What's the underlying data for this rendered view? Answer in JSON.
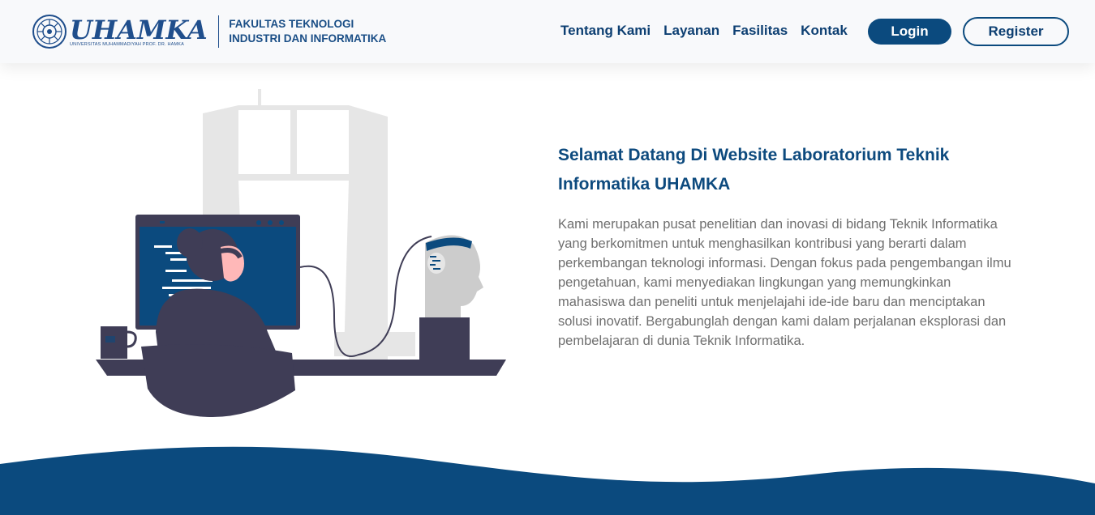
{
  "header": {
    "logo_text": "UHAMKA",
    "logo_subtext": "UNIVERSITAS MUHAMMADIYAH PROF. DR. HAMKA",
    "faculty_line1": "FAKULTAS TEKNOLOGI",
    "faculty_line2": "INDUSTRI DAN INFORMATIKA"
  },
  "nav": {
    "items": [
      {
        "label": "Tentang Kami"
      },
      {
        "label": "Layanan"
      },
      {
        "label": "Fasilitas"
      },
      {
        "label": "Kontak"
      }
    ],
    "login_label": "Login",
    "register_label": "Register"
  },
  "hero": {
    "title": "Selamat Datang Di Website Laboratorium Teknik Informatika UHAMKA",
    "description": "Kami merupakan pusat penelitian dan inovasi di bidang Teknik Informatika yang berkomitmen untuk menghasilkan kontribusi yang berarti dalam perkembangan teknologi informasi. Dengan fokus pada pengembangan ilmu pengetahuan, kami menyediakan lingkungan yang memungkinkan mahasiswa dan peneliti untuk menjelajahi ide-ide baru dan menciptakan solusi inovatif. Bergabunglah dengan kami dalam perjalanan eksplorasi dan pembelajaran di dunia Teknik Informatika.",
    "illustration": "person-at-computer-with-robot-head-illustration"
  },
  "colors": {
    "primary": "#0b4a7e",
    "nav_text": "#0d3f72",
    "body_text": "#6f6f6f",
    "header_bg": "#f8f9fb",
    "wave": "#0b4a7e"
  }
}
